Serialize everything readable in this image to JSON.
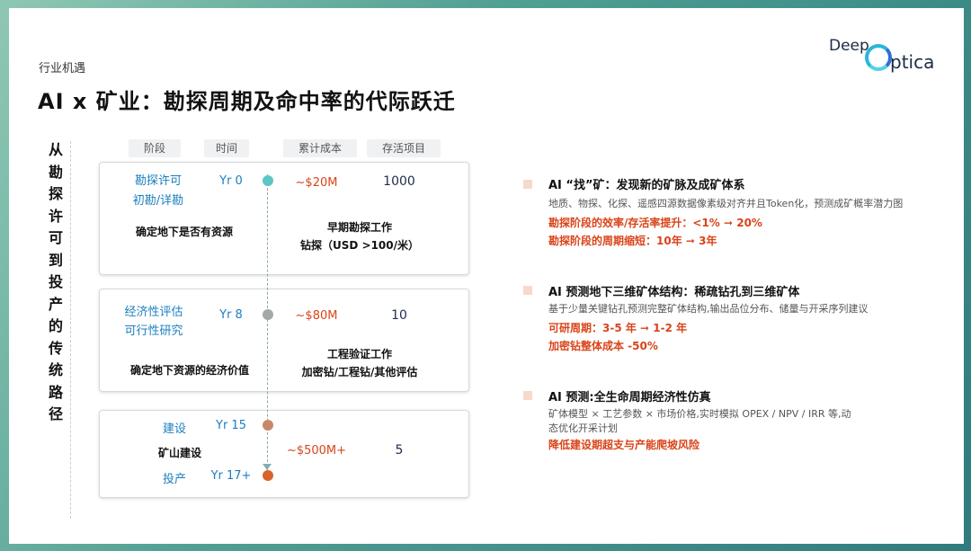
{
  "section_label": "行业机遇",
  "logo": {
    "deep": "Deep",
    "optica": "ptica"
  },
  "title": "AI x 矿业：勘探周期及命中率的代际跃迁",
  "vertical_label": [
    "从",
    "勘",
    "探",
    "许",
    "可",
    "到",
    "投",
    "产",
    "的",
    "传",
    "统",
    "路",
    "径"
  ],
  "headers": {
    "stage": "阶段",
    "time": "时间",
    "cost": "累计成本",
    "survive": "存活项目"
  },
  "cards": [
    {
      "stage_line1": "勘探许可",
      "stage_line2": "初勘/详勘",
      "time": "Yr 0",
      "cost": "~$20M",
      "survive": "1000",
      "goal": "确定地下是否有资源",
      "work_line1": "早期勘探工作",
      "work_line2": "钻探（USD >100/米）"
    },
    {
      "stage_line1": "经济性评估",
      "stage_line2": "可行性研究",
      "time": "Yr 8",
      "cost": "~$80M",
      "survive": "10",
      "goal": "确定地下资源的经济价值",
      "work_line1": "工程验证工作",
      "work_line2": "加密钻/工程钻/其他评估"
    },
    {
      "stage1": "建设",
      "time1": "Yr 15",
      "middle": "矿山建设",
      "cost": "~$500M+",
      "survive": "5",
      "stage2": "投产",
      "time2": "Yr 17+"
    }
  ],
  "colors": {
    "dot1": "#5cc6c6",
    "dot2": "#a3aaa5",
    "dot3": "#c9876a",
    "dot4": "#d9632a",
    "accent_red": "#d9441a",
    "accent_blue": "#1a7fc0"
  },
  "right_items": [
    {
      "heading": "AI “找”矿：发现新的矿脉及成矿体系",
      "sub": [
        "地质、物探、化探、遥感四源数据像素级对齐并且Token化，预测成矿概率潜力图"
      ],
      "results": [
        "勘探阶段的效率/存活率提升：<1% ➞ 20%",
        "勘探阶段的周期缩短：10年 ➞ 3年"
      ]
    },
    {
      "heading": "AI 预测地下三维矿体结构：稀疏钻孔到三维矿体",
      "sub": [
        "基于少量关键钻孔预测完整矿体结构,输出品位分布、储量与开采序列建议"
      ],
      "results": [
        "可研周期：3-5 年 ➞ 1-2 年",
        "加密钻整体成本 -50%"
      ]
    },
    {
      "heading": "AI 预测:全生命周期经济性仿真",
      "sub": [
        "矿体模型 × 工艺参数 × 市场价格,实时模拟 OPEX / NPV / IRR 等,动",
        "态优化开采计划"
      ],
      "results": [
        "降低建设期超支与产能爬坡风险"
      ]
    }
  ]
}
